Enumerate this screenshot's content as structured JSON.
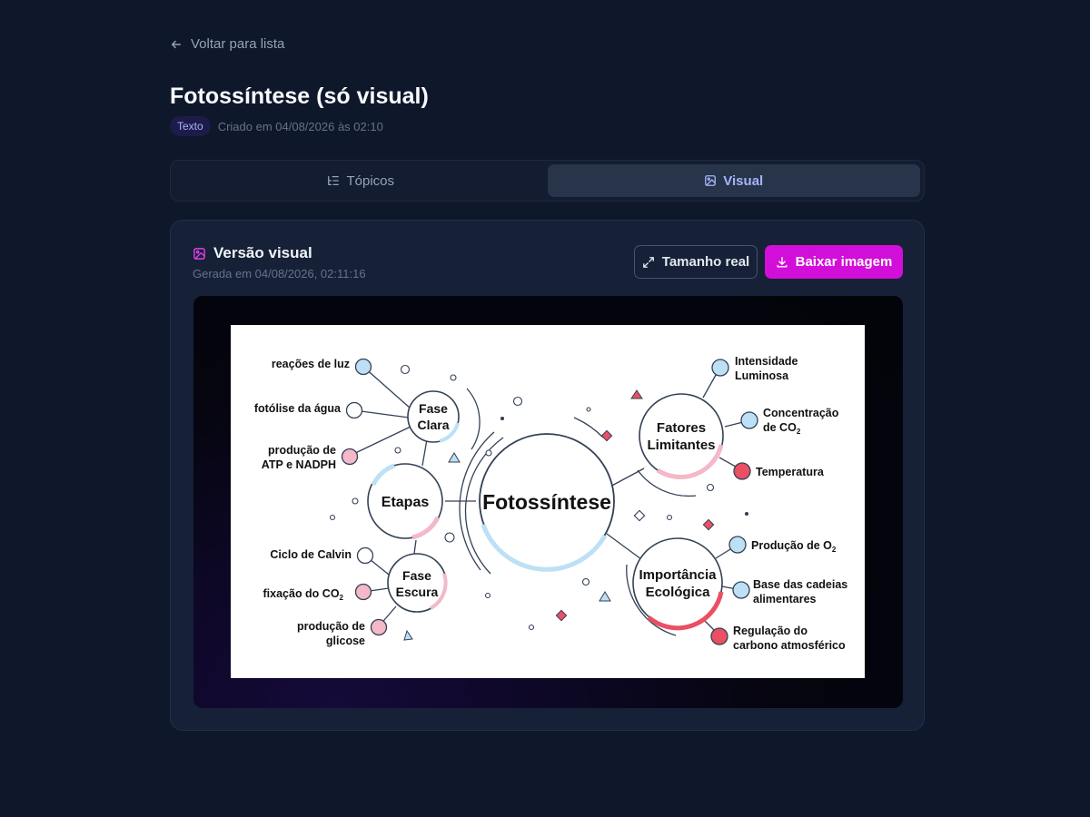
{
  "nav": {
    "back_label": "Voltar para lista"
  },
  "page": {
    "title": "Fotossíntese (só visual)",
    "badge": "Texto",
    "created": "Criado em 04/08/2026 às 02:10"
  },
  "tabs": [
    {
      "label": "Tópicos",
      "icon": "list-tree-icon",
      "active": false
    },
    {
      "label": "Visual",
      "icon": "image-icon",
      "active": true
    }
  ],
  "visual": {
    "title": "Versão visual",
    "generated": "Gerada em 04/08/2026, 02:11:16",
    "actual_size_label": "Tamanho real",
    "download_label": "Baixar imagem"
  },
  "mindmap": {
    "center": "Fotossíntese",
    "etapas": "Etapas",
    "fase_clara": [
      "Fase",
      "Clara"
    ],
    "fase_escura": [
      "Fase",
      "Escura"
    ],
    "fatores": [
      "Fatores",
      "Limitantes"
    ],
    "importancia": [
      "Importância",
      "Ecológica"
    ],
    "clara_items": [
      "reações de luz",
      "fotólise da água",
      "produção de",
      "ATP e NADPH"
    ],
    "escura_items": [
      "Ciclo de Calvin",
      "fixação do CO",
      "produção de",
      "glicose"
    ],
    "fatores_items": [
      "Intensidade",
      "Luminosa",
      "Concentração",
      "de CO",
      "Temperatura"
    ],
    "importancia_items": [
      "Produção de O",
      "Base das cadeias",
      "alimentares",
      "Regulação do",
      "carbono atmosférico"
    ],
    "subscript_2": "2"
  },
  "colors": {
    "accent": "#d20fd8",
    "tab_active": "#a5b4fc",
    "node_blue": "#bde0f6",
    "node_pink": "#f4b8c8",
    "node_red": "#ea4f62"
  }
}
